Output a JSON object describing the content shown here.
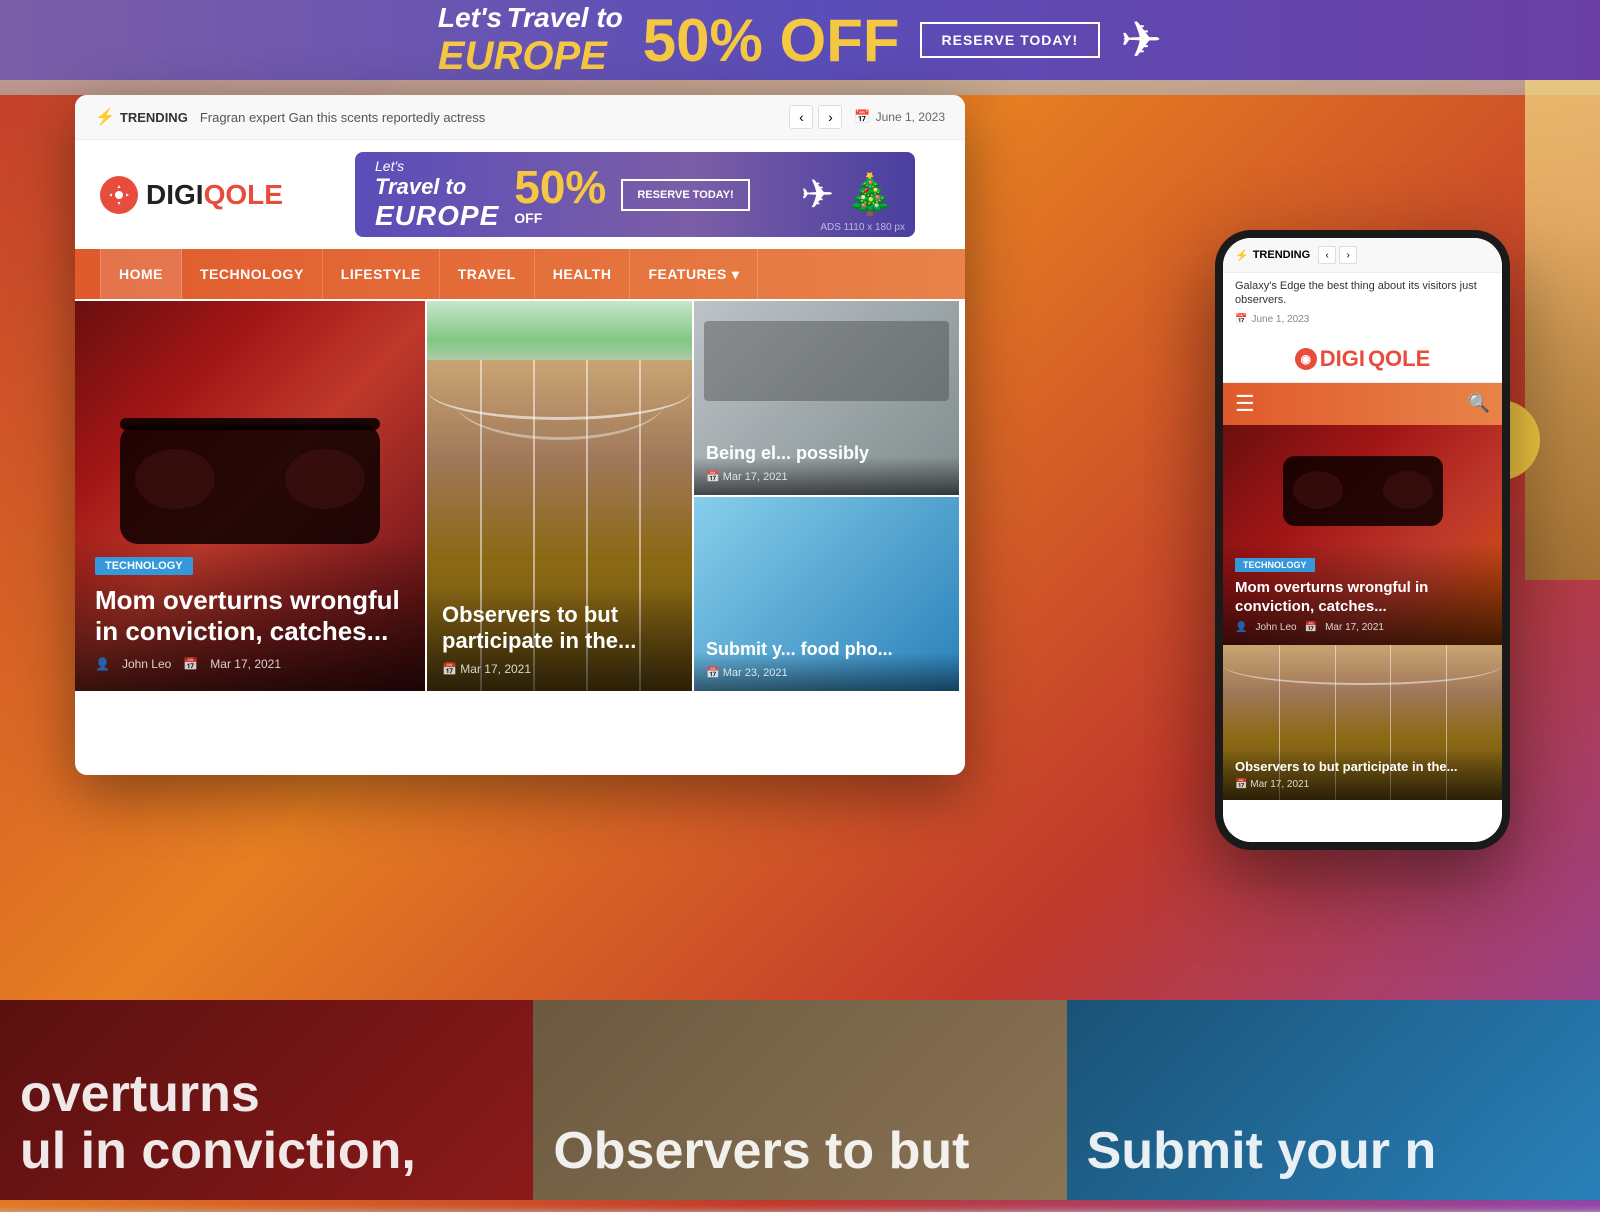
{
  "site": {
    "name": "DIGIQOLE",
    "logo_prefix": "DIGI",
    "logo_suffix": "QOLE"
  },
  "trending": {
    "label": "TRENDING",
    "text": "Fragran expert Gan this scents reportedly actress",
    "date": "June 1, 2023",
    "phone_text": "Galaxy's Edge the best thing about its visitors just observers.",
    "phone_date": "June 1, 2023"
  },
  "top_banner": {
    "lets": "Let's",
    "travel_to": "Travel to",
    "europe": "EUROPE",
    "percent": "50%",
    "off": "OFF",
    "btn_label": "RESERVE TODAY!",
    "ads_label": "ADS 1110 x 180 px"
  },
  "nav": {
    "items": [
      {
        "label": "HOME",
        "active": true
      },
      {
        "label": "TECHNOLOGY",
        "active": false
      },
      {
        "label": "LIFESTYLE",
        "active": false
      },
      {
        "label": "TRAVEL",
        "active": false
      },
      {
        "label": "HEALTH",
        "active": false
      },
      {
        "label": "FEATURES",
        "has_chevron": true
      }
    ]
  },
  "articles": {
    "main": {
      "badge": "TECHNOLOGY",
      "title": "Mom overturns wrongful in conviction, catches...",
      "author": "John Leo",
      "date": "Mar 17, 2021"
    },
    "center": {
      "title": "Observers to but participate in the...",
      "date": "Mar 17, 2021"
    },
    "right_top": {
      "title": "Being el... possibly",
      "date": "Mar 17, 2021"
    },
    "right_bottom": {
      "title": "Submit y... food pho...",
      "date": "Mar 23, 2021"
    }
  },
  "phone": {
    "nav_menu": "☰",
    "nav_search": "🔍",
    "main_card": {
      "badge": "TECHNOLOGY",
      "title": "Mom overturns wrongful in conviction, catches...",
      "author": "John Leo",
      "date": "Mar 17, 2021"
    },
    "bottom_card": {
      "title": "Observers to but participate in the...",
      "date": "Mar 17, 2021"
    }
  },
  "bottom_texts": {
    "left": "overturns",
    "left2": "ul in conviction,",
    "center": "Observers to but",
    "right": "Submit your n"
  },
  "colors": {
    "primary": "#e05a2b",
    "secondary": "#e8834a",
    "tech_badge": "#3498db",
    "logo_accent": "#e74c3c",
    "banner_bg": "#5b4db8"
  }
}
